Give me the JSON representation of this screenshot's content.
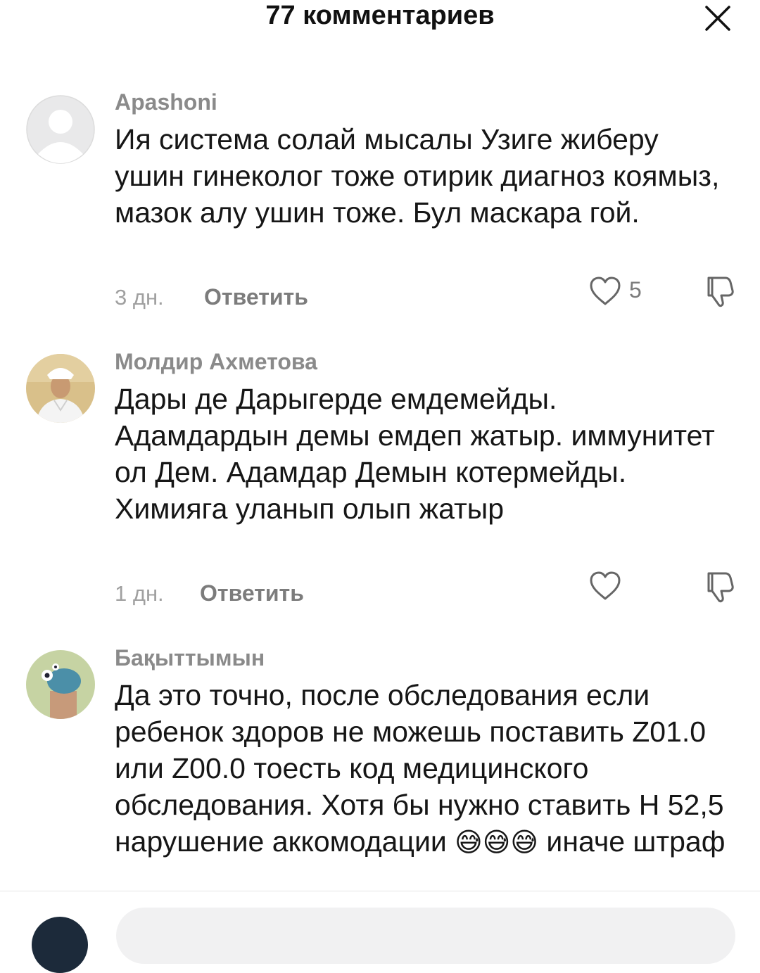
{
  "header": {
    "title": "77 комментариев"
  },
  "comments": [
    {
      "username": "Apashoni",
      "avatar": "default-avatar",
      "text": "Ия система солай мысалы Узиге жиберу ушин гинеколог тоже отирик диагноз коямыз, мазок алу ушин тоже. Бул маскара гой.",
      "time": "3 дн.",
      "reply_label": "Ответить",
      "likes": "5"
    },
    {
      "username": "Молдир Ахметова",
      "avatar": "photo-avatar",
      "text": "Дары де Дарыгерде емдемейды. Адамдардын демы емдеп жатыр. иммунитет ол Дем. Адамдар Демын котермейды. Химияга уланып олып жатыр",
      "time": "1 дн.",
      "reply_label": "Ответить",
      "likes": ""
    },
    {
      "username": "Бақыттымын",
      "avatar": "illustration-avatar",
      "text": "Да это точно, после обследования если ребенок здоров не можешь поставить Z01.0 или Z00.0 тоесть код медицинского обследования. Хотя бы нужно ставить Н 52,5 нарушение аккомодации",
      "emoji": "😅😅😅",
      "text_end": "иначе штраф"
    }
  ],
  "icons": {
    "close": "close-icon",
    "like": "heart-icon",
    "dislike": "thumbs-down-icon"
  },
  "colors": {
    "muted_text": "#8a8a8a",
    "input_background": "#f1f1f2"
  }
}
